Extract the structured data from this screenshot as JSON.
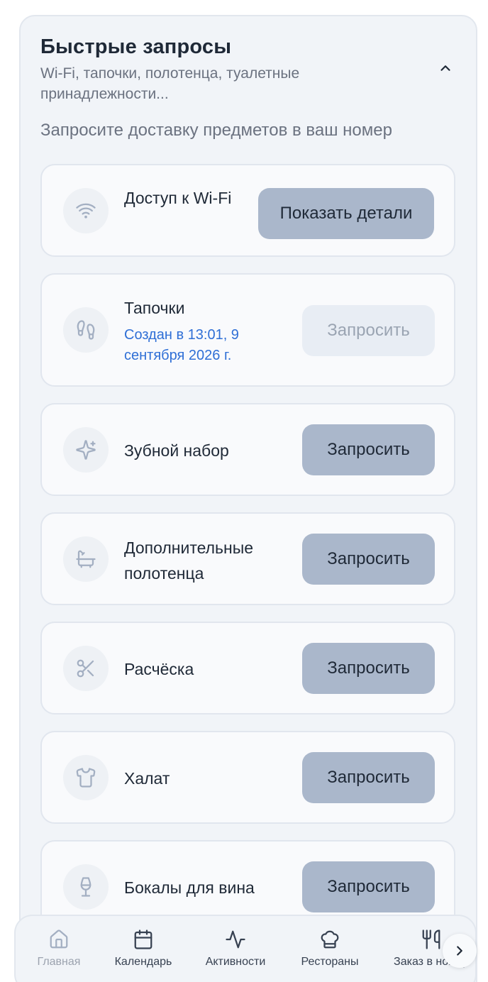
{
  "section": {
    "title": "Быстрые запросы",
    "subtitle": "Wi-Fi, тапочки, полотенца, туалетные принадлежности...",
    "hint": "Запросите доставку предметов в ваш номер"
  },
  "items": [
    {
      "icon": "wifi-icon",
      "label": "Доступ к Wi-Fi",
      "button": "Показать детали"
    },
    {
      "icon": "footprints-icon",
      "label": "Тапочки",
      "status": "Создан в 13:01, 9 сентября 2026 г.",
      "button": "Запросить",
      "button_state": "disabled"
    },
    {
      "icon": "sparkles-icon",
      "label": "Зубной набор",
      "button": "Запросить"
    },
    {
      "icon": "bath-icon",
      "label": "Дополнительные полотенца",
      "button": "Запросить"
    },
    {
      "icon": "scissors-icon",
      "label": "Расчёска",
      "button": "Запросить"
    },
    {
      "icon": "shirt-icon",
      "label": "Халат",
      "button": "Запросить"
    },
    {
      "icon": "wine-glass-icon",
      "label": "Бокалы для вина",
      "button": "Запросить"
    }
  ],
  "nav": {
    "items": [
      {
        "icon": "home-icon",
        "label": "Главная",
        "active": true
      },
      {
        "icon": "calendar-icon",
        "label": "Календарь"
      },
      {
        "icon": "activity-icon",
        "label": "Активности"
      },
      {
        "icon": "chef-hat-icon",
        "label": "Рестораны"
      },
      {
        "icon": "utensils-icon",
        "label": "Заказ в номер"
      }
    ],
    "more_icon": "chevron-right-icon"
  },
  "colors": {
    "accent_button": "#aab7cb",
    "status_text": "#2f6fd6",
    "panel_bg": "#f1f4f8"
  }
}
